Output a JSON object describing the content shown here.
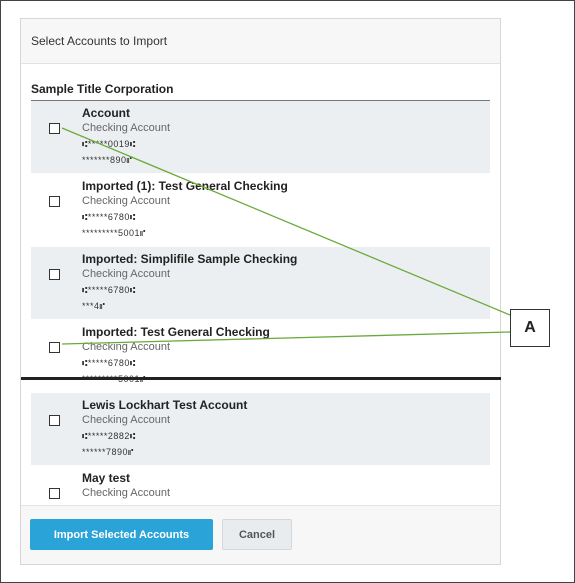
{
  "dialog": {
    "title": "Select Accounts to Import",
    "org_name": "Sample Title Corporation"
  },
  "accounts": [
    {
      "title": "Account",
      "type": "Checking Account",
      "routing": "⑆*****0019⑆",
      "account": "*******890⑈"
    },
    {
      "title": "Imported (1): Test General Checking",
      "type": "Checking Account",
      "routing": "⑆*****6780⑆",
      "account": "*********5001⑈"
    },
    {
      "title": "Imported: Simplifile Sample Checking",
      "type": "Checking Account",
      "routing": "⑆*****6780⑆",
      "account": "***4⑈"
    },
    {
      "title": "Imported: Test General Checking",
      "type": "Checking Account",
      "routing": "⑆*****6780⑆",
      "account": "*********5001⑈"
    },
    {
      "title": "Lewis Lockhart Test Account",
      "type": "Checking Account",
      "routing": "⑆*****2882⑆",
      "account": "******7890⑈"
    },
    {
      "title": "May test",
      "type": "Checking Account",
      "routing": "",
      "account": ""
    }
  ],
  "footer": {
    "import_label": "Import Selected Accounts",
    "cancel_label": "Cancel"
  },
  "callout": {
    "label": "A",
    "line_color": "#6aaa3a"
  }
}
